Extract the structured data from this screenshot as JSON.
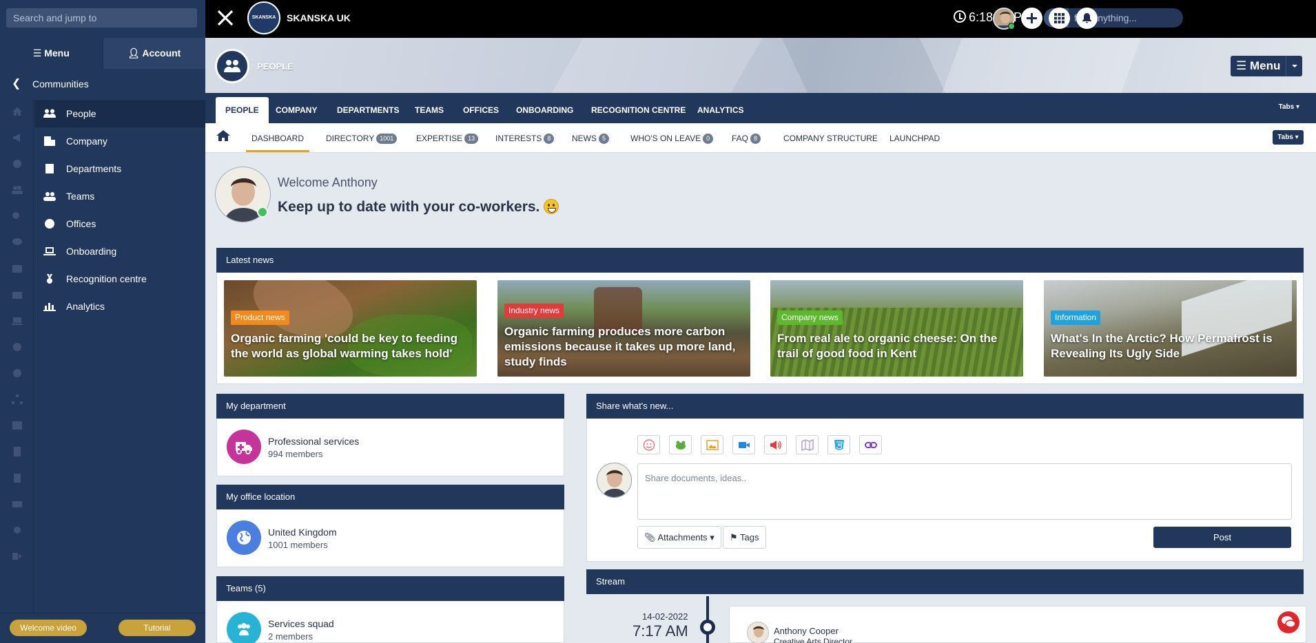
{
  "sidebar": {
    "search_placeholder": "Search and jump to",
    "tabs": {
      "menu": "Menu",
      "account": "Account"
    },
    "back_label": "Communities",
    "items": [
      {
        "label": "People",
        "icon": "users-icon",
        "active": true
      },
      {
        "label": "Company",
        "icon": "building-icon"
      },
      {
        "label": "Departments",
        "icon": "building-columns-icon"
      },
      {
        "label": "Teams",
        "icon": "team-icon"
      },
      {
        "label": "Offices",
        "icon": "globe-icon"
      },
      {
        "label": "Onboarding",
        "icon": "laptop-icon"
      },
      {
        "label": "Recognition centre",
        "icon": "medal-icon"
      },
      {
        "label": "Analytics",
        "icon": "bar-chart-icon"
      }
    ],
    "bottom": {
      "welcome_video": "Welcome video",
      "tutorial": "Tutorial"
    },
    "accent": "#c9a23c"
  },
  "topbar": {
    "brand": "SKANSKA UK",
    "logo_text": "SKANSKA",
    "time": "6:18:03 PM",
    "search_placeholder": "find anything..."
  },
  "banner": {
    "title": "PEOPLE",
    "menu_label": "Menu"
  },
  "tabs_primary": {
    "items": [
      "PEOPLE",
      "COMPANY",
      "DEPARTMENTS",
      "TEAMS",
      "OFFICES",
      "ONBOARDING",
      "RECOGNITION CENTRE",
      "ANALYTICS"
    ],
    "dropdown": "Tabs"
  },
  "tabs_secondary": {
    "items": [
      {
        "label": "DASHBOARD",
        "badge": null
      },
      {
        "label": "DIRECTORY",
        "badge": "1001"
      },
      {
        "label": "EXPERTISE",
        "badge": "13"
      },
      {
        "label": "INTERESTS",
        "badge": "8"
      },
      {
        "label": "NEWS",
        "badge": "5"
      },
      {
        "label": "WHO'S ON LEAVE",
        "badge": "0"
      },
      {
        "label": "FAQ",
        "badge": "8"
      },
      {
        "label": "COMPANY STRUCTURE",
        "badge": null
      },
      {
        "label": "LAUNCHPAD",
        "badge": null
      }
    ],
    "dropdown": "Tabs"
  },
  "welcome": {
    "greeting": "Welcome Anthony",
    "message": "Keep up to date with your co-workers."
  },
  "latest_news": {
    "title": "Latest news",
    "cards": [
      {
        "tag": "Product news",
        "tag_color": "#f08a1c",
        "title": "Organic farming 'could be key to feeding the world as global warming takes hold'"
      },
      {
        "tag": "Industry news",
        "tag_color": "#e23b3b",
        "title": "Organic farming produces more carbon emissions because it takes up more land, study finds"
      },
      {
        "tag": "Company news",
        "tag_color": "#5cb82e",
        "title": "From real ale to organic cheese: On the trail of good food in Kent"
      },
      {
        "tag": "Information",
        "tag_color": "#1fa3e0",
        "title": "What's In the Arctic? How Permafrost is Revealing Its Ugly Side"
      }
    ]
  },
  "my_department": {
    "title": "My department",
    "name": "Professional services",
    "members": "994 members",
    "color": "#c4349b"
  },
  "my_office": {
    "title": "My office location",
    "name": "United Kingdom",
    "members": "1001 members",
    "color": "#4a7ee0"
  },
  "teams": {
    "title": "Teams (5)",
    "name": "Services squad",
    "members": "2 members",
    "color": "#26b3d6"
  },
  "share": {
    "title": "Share what's new...",
    "placeholder": "Share documents, ideas..",
    "attachments": "Attachments",
    "tags": "Tags",
    "post": "Post",
    "tools": [
      "emoji-icon",
      "frog-icon",
      "image-icon",
      "video-icon",
      "megaphone-icon",
      "map-icon",
      "html5-icon",
      "link-icon"
    ]
  },
  "stream": {
    "title": "Stream",
    "date": "14-02-2022",
    "time": "7:17 AM",
    "author": "Anthony Cooper",
    "role": "Creative Arts Director"
  }
}
